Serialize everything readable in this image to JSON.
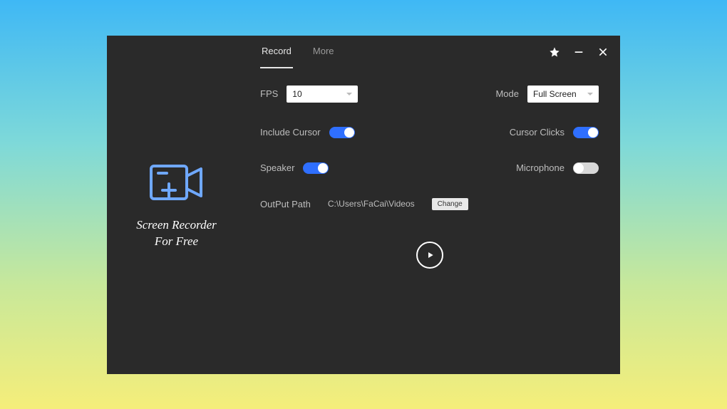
{
  "app": {
    "title_line1": "Screen Recorder",
    "title_line2": "For Free"
  },
  "tabs": {
    "record": "Record",
    "more": "More"
  },
  "settings": {
    "fps": {
      "label": "FPS",
      "value": "10"
    },
    "mode": {
      "label": "Mode",
      "value": "Full Screen"
    },
    "include_cursor": {
      "label": "Include Cursor",
      "on": true
    },
    "cursor_clicks": {
      "label": "Cursor Clicks",
      "on": true
    },
    "speaker": {
      "label": "Speaker",
      "on": true
    },
    "microphone": {
      "label": "Microphone",
      "on": false
    },
    "output_path": {
      "label": "OutPut Path",
      "value": "C:\\Users\\FaCai\\Videos",
      "change": "Change"
    }
  }
}
